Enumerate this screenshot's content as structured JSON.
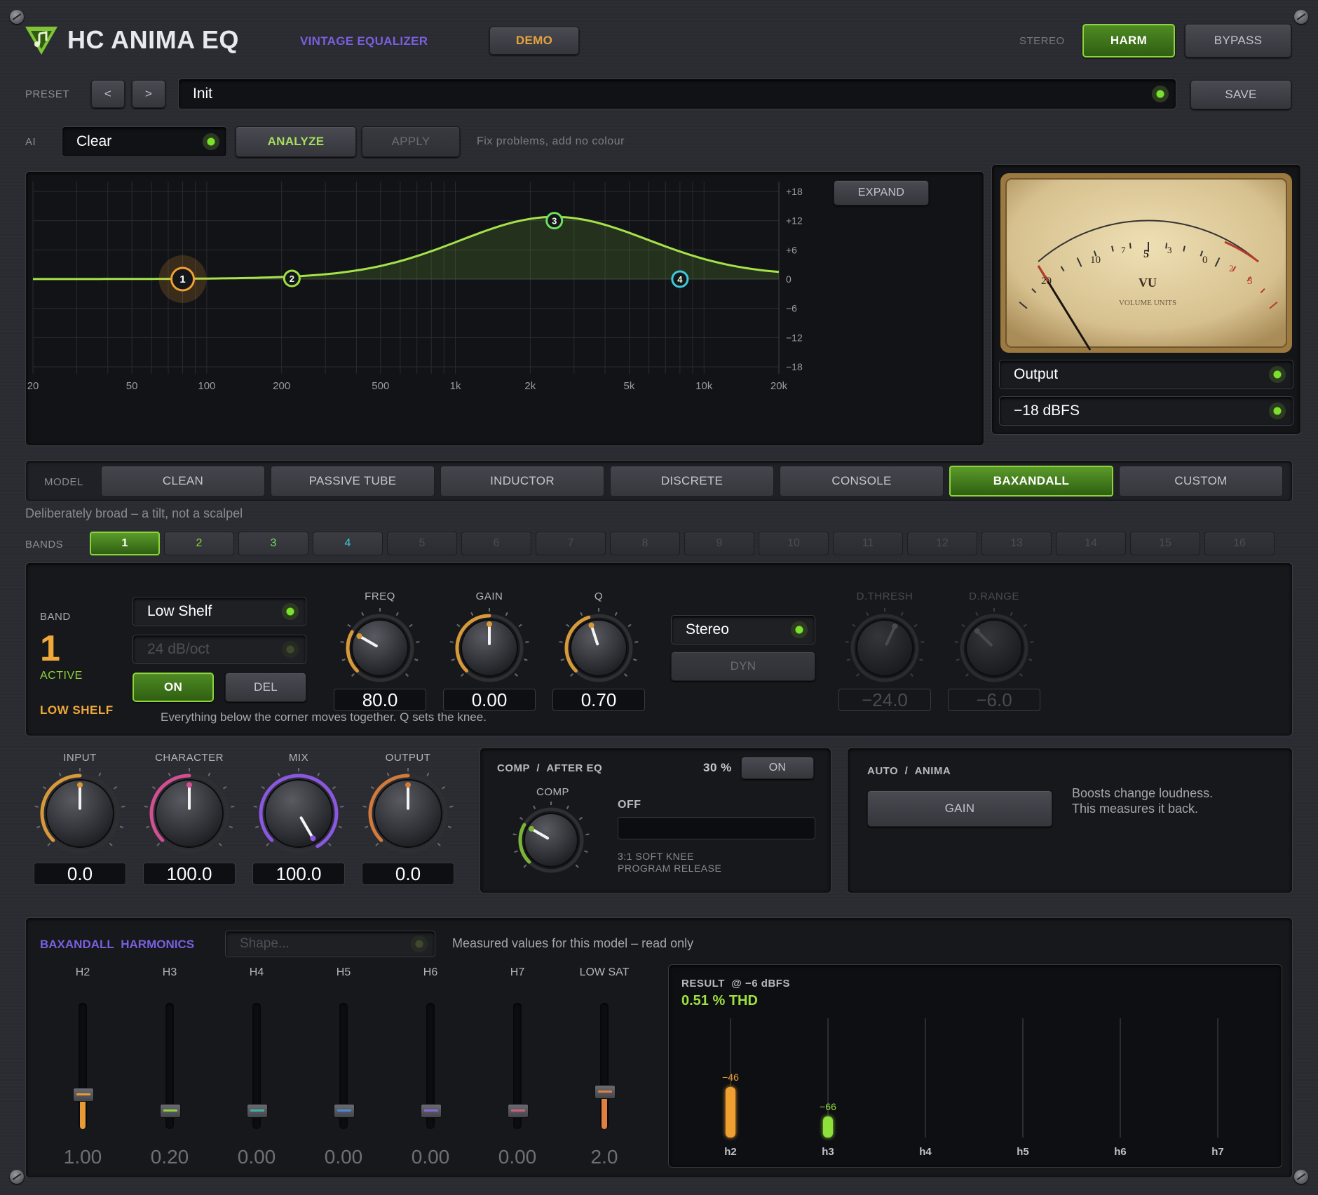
{
  "header": {
    "title": "HC ANIMA EQ",
    "subtitle": "VINTAGE EQUALIZER",
    "demo_label": "DEMO",
    "stereo_label": "STEREO",
    "harm_label": "HARM",
    "bypass_label": "BYPASS"
  },
  "preset": {
    "label": "PRESET",
    "prev": "<",
    "next": ">",
    "value": "Init",
    "save_label": "SAVE"
  },
  "ai": {
    "label": "AI",
    "mode": "Clear",
    "analyze_label": "ANALYZE",
    "apply_label": "APPLY",
    "hint": "Fix problems, add no colour"
  },
  "graph": {
    "expand_label": "EXPAND",
    "x_ticks": [
      "20",
      "50",
      "100",
      "200",
      "500",
      "1k",
      "2k",
      "5k",
      "10k",
      "20k"
    ],
    "y_ticks": [
      "+18",
      "+12",
      "+6",
      "0",
      "−6",
      "−12",
      "−18"
    ],
    "nodes": [
      {
        "label": "1",
        "freq": 80,
        "gain": 0,
        "color": "#f0a030"
      },
      {
        "label": "2",
        "freq": 220,
        "gain": 0,
        "color": "#9ee040"
      },
      {
        "label": "3",
        "freq": 2500,
        "gain": 12,
        "color": "#6ee060"
      },
      {
        "label": "4",
        "freq": 8000,
        "gain": 0,
        "color": "#40c8d8"
      }
    ]
  },
  "meter": {
    "scale": [
      "20",
      "10",
      "7",
      "5",
      "3",
      "0",
      "2",
      "3"
    ],
    "unit": "VU",
    "caption": "VOLUME UNITS",
    "source": "Output",
    "reference": "−18 dBFS"
  },
  "model": {
    "label": "MODEL",
    "options": [
      "CLEAN",
      "PASSIVE TUBE",
      "INDUCTOR",
      "DISCRETE",
      "CONSOLE",
      "BAXANDALL",
      "CUSTOM"
    ],
    "selected": "BAXANDALL",
    "description": "Deliberately broad – a tilt, not a scalpel"
  },
  "bands": {
    "label": "BANDS",
    "items": [
      "1",
      "2",
      "3",
      "4",
      "5",
      "6",
      "7",
      "8",
      "9",
      "10",
      "11",
      "12",
      "13",
      "14",
      "15",
      "16"
    ],
    "selected": "1"
  },
  "band_panel": {
    "band_label": "BAND",
    "number": "1",
    "state": "ACTIVE",
    "type_name": "LOW SHELF",
    "type": "Low Shelf",
    "slope": "24 dB/oct",
    "on_label": "ON",
    "del_label": "DEL",
    "hint": "Everything below the corner moves together.  Q sets the knee.",
    "stereo_mode": "Stereo",
    "dyn_label": "DYN",
    "knobs": [
      {
        "label": "FREQ",
        "value": "80.0"
      },
      {
        "label": "GAIN",
        "value": "0.00"
      },
      {
        "label": "Q",
        "value": "0.70"
      },
      {
        "label": "D.THRESH",
        "value": "−24.0"
      },
      {
        "label": "D.RANGE",
        "value": "−6.0"
      }
    ]
  },
  "macro": {
    "knobs": [
      {
        "label": "INPUT",
        "value": "0.0",
        "color": "#d79a3a"
      },
      {
        "label": "CHARACTER",
        "value": "100.0",
        "color": "#d24f93"
      },
      {
        "label": "MIX",
        "value": "100.0",
        "color": "#8a58e0"
      },
      {
        "label": "OUTPUT",
        "value": "0.0",
        "color": "#d07a3e"
      }
    ]
  },
  "comp": {
    "title": "COMP",
    "position": "AFTER EQ",
    "amount": "30 %",
    "on_label": "ON",
    "knob_label": "COMP",
    "state": "OFF",
    "detail1": "3:1  SOFT KNEE",
    "detail2": "PROGRAM RELEASE"
  },
  "auto": {
    "title": "AUTO",
    "sub": "ANIMA",
    "gain_label": "GAIN",
    "desc1": "Boosts change loudness.",
    "desc2": "This measures it back."
  },
  "harmonics": {
    "model": "BAXANDALL",
    "title": "HARMONICS",
    "shape_placeholder": "Shape...",
    "note": "Measured values for this model – read only",
    "faders": [
      {
        "label": "H2",
        "value": "1.00",
        "color": "#e89a35"
      },
      {
        "label": "H3",
        "value": "0.20",
        "color": "#8cd43a"
      },
      {
        "label": "H4",
        "value": "0.00",
        "color": "#3fb2a8"
      },
      {
        "label": "H5",
        "value": "0.00",
        "color": "#4a8ad8"
      },
      {
        "label": "H6",
        "value": "0.00",
        "color": "#8a68d8"
      },
      {
        "label": "H7",
        "value": "0.00",
        "color": "#d0607a"
      },
      {
        "label": "LOW SAT",
        "value": "2.0",
        "color": "#e08040"
      }
    ],
    "result_label": "RESULT",
    "result_ref": "@ −6 dBFS",
    "thd": "0.51 % THD",
    "bars": [
      {
        "label": "h2",
        "value": "−46",
        "level": -46,
        "color": "#f0a030"
      },
      {
        "label": "h3",
        "value": "−66",
        "level": -66,
        "color": "#8ee03a"
      },
      {
        "label": "h4",
        "value": "",
        "level": null
      },
      {
        "label": "h5",
        "value": "",
        "level": null
      },
      {
        "label": "h6",
        "value": "",
        "level": null
      },
      {
        "label": "h7",
        "value": "",
        "level": null
      }
    ]
  }
}
